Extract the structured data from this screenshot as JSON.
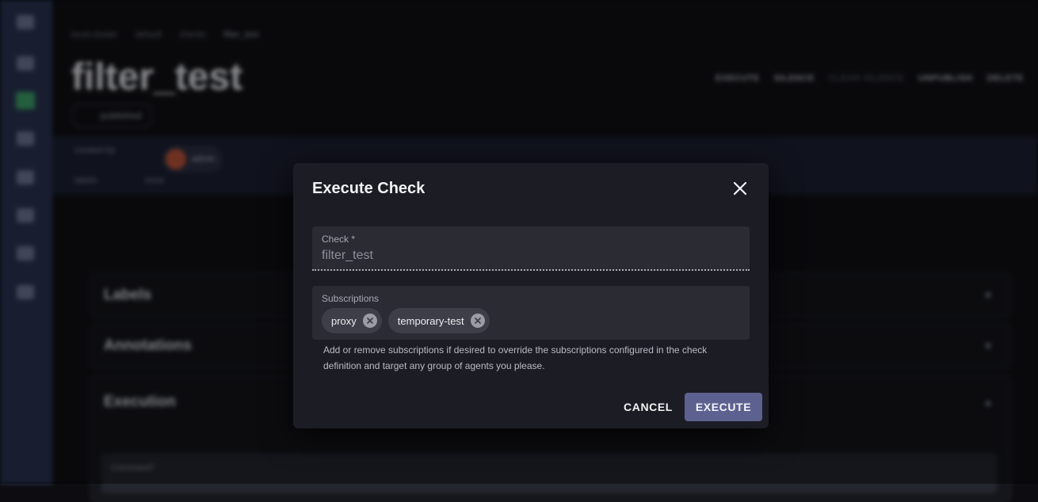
{
  "background": {
    "breadcrumb": [
      "local-cluster",
      "default",
      "checks",
      "filter_test"
    ],
    "page_title": "filter_test",
    "status_badge": "published",
    "actions": {
      "execute": "EXECUTE",
      "silence": "SILENCE",
      "clear_silence": "CLEAR SILENCE",
      "unpublish": "UNPUBLISH",
      "delete": "DELETE"
    },
    "info": {
      "created_by_label": "created by",
      "created_by_value": "admin",
      "labels_label": "labels",
      "labels_value": "none"
    },
    "panels": {
      "labels": "Labels",
      "annotations": "Annotations",
      "execution": "Execution",
      "command_label": "Command*"
    }
  },
  "dialog": {
    "title": "Execute Check",
    "check_field": {
      "label": "Check *",
      "value": "filter_test"
    },
    "subscriptions_field": {
      "label": "Subscriptions",
      "chips": [
        "proxy",
        "temporary-test"
      ]
    },
    "helper_text": "Add or remove subscriptions if desired to override the subscriptions configured in the check definition and target any group of agents you please.",
    "cancel_label": "CANCEL",
    "execute_label": "EXECUTE"
  },
  "colors": {
    "dialog_bg": "#1c1d24",
    "primary_button": "#5d6190",
    "sidebar": "#2a3554",
    "active_nav": "#3da46b"
  }
}
